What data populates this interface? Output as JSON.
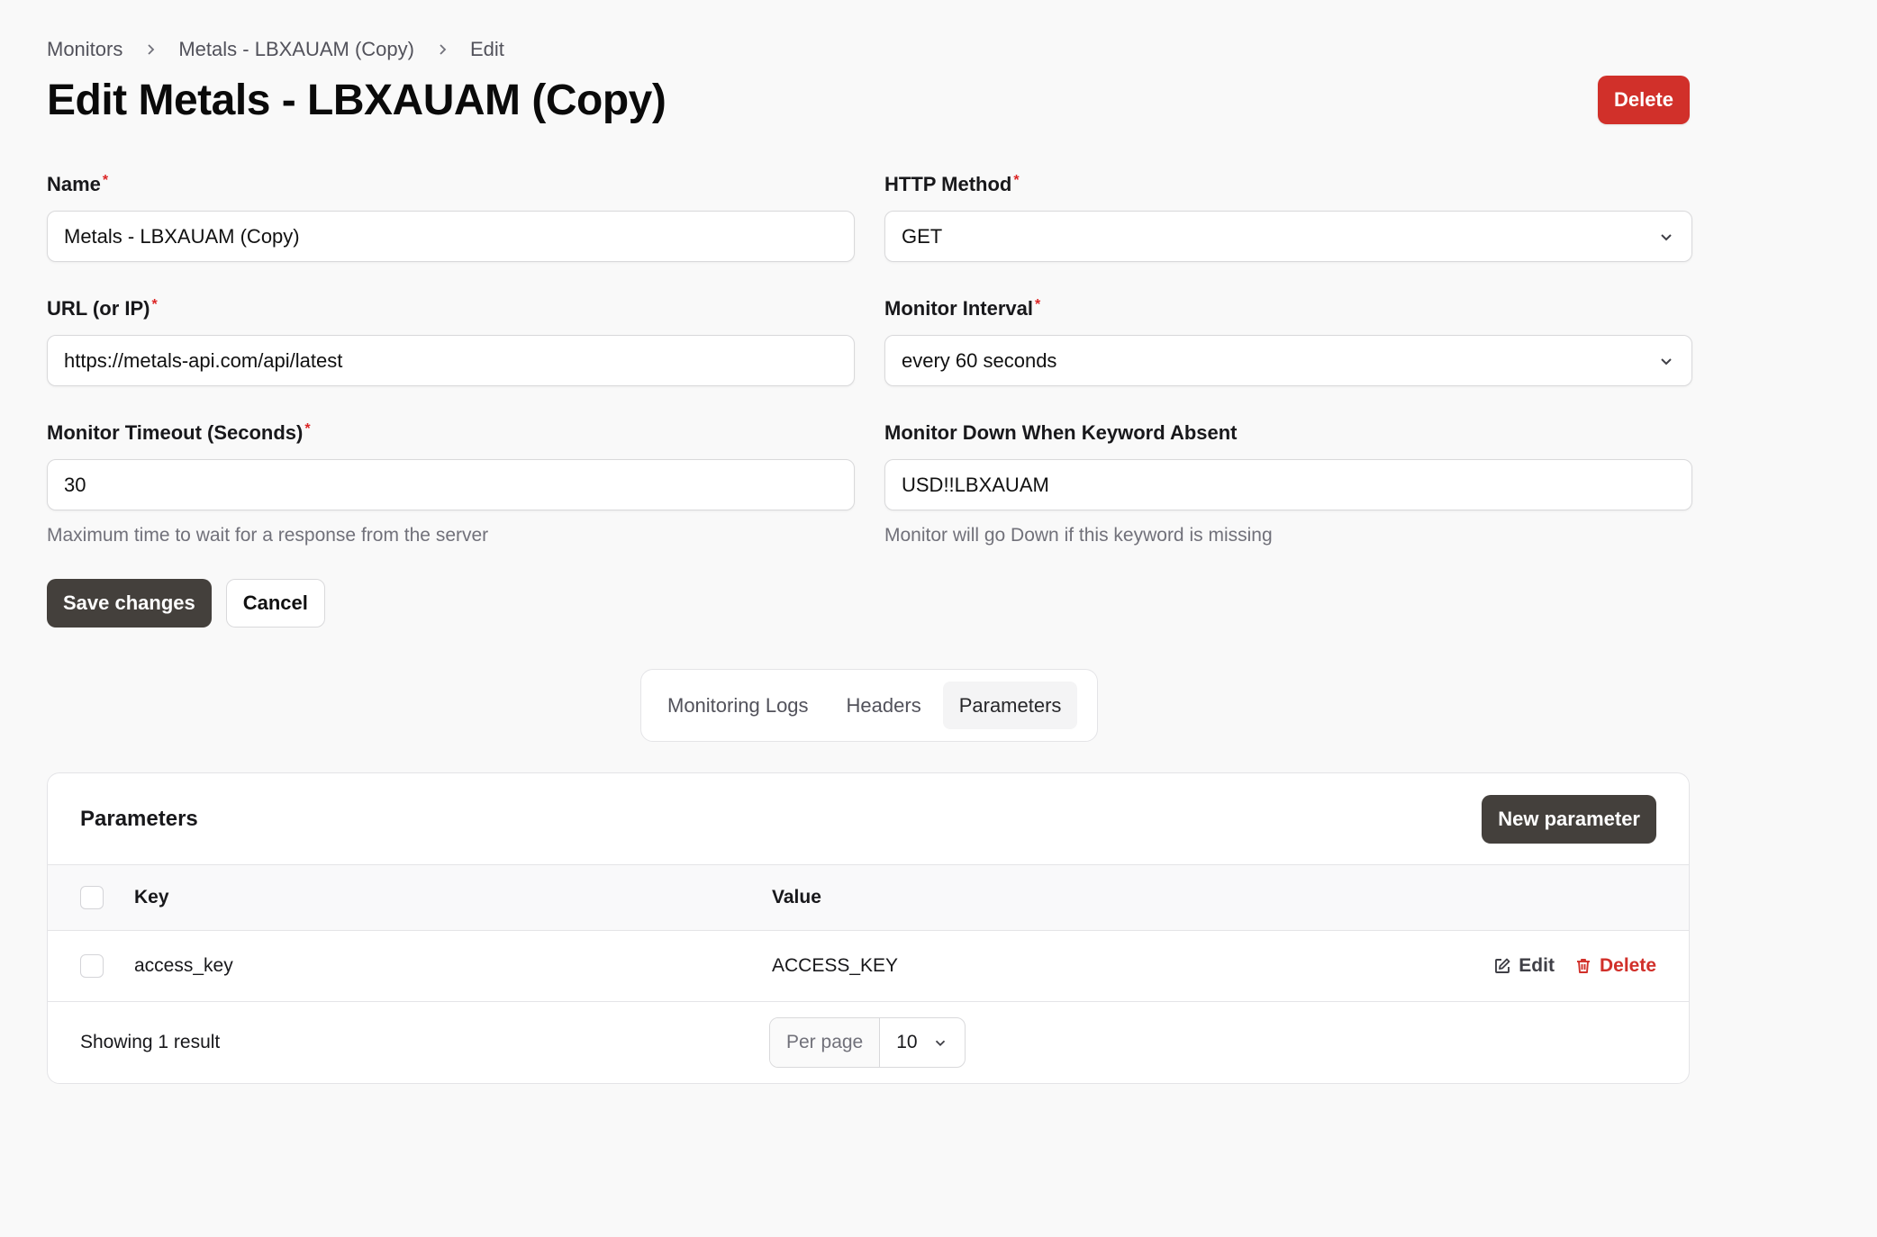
{
  "breadcrumb": {
    "items": [
      "Monitors",
      "Metals - LBXAUAM (Copy)",
      "Edit"
    ]
  },
  "page": {
    "title": "Edit Metals - LBXAUAM (Copy)",
    "delete_label": "Delete"
  },
  "form": {
    "name": {
      "label": "Name",
      "required": "*",
      "value": "Metals - LBXAUAM (Copy)"
    },
    "http_method": {
      "label": "HTTP Method",
      "required": "*",
      "value": "GET"
    },
    "url": {
      "label": "URL (or IP)",
      "required": "*",
      "value": "https://metals-api.com/api/latest"
    },
    "interval": {
      "label": "Monitor Interval",
      "required": "*",
      "value": "every 60 seconds"
    },
    "timeout": {
      "label": "Monitor Timeout (Seconds)",
      "required": "*",
      "value": "30",
      "hint": "Maximum time to wait for a response from the server"
    },
    "keyword": {
      "label": "Monitor Down When Keyword Absent",
      "value": "USD!!LBXAUAM",
      "hint": "Monitor will go Down if this keyword is missing"
    },
    "save_label": "Save changes",
    "cancel_label": "Cancel"
  },
  "tabs": [
    {
      "label": "Monitoring Logs",
      "active": false
    },
    {
      "label": "Headers",
      "active": false
    },
    {
      "label": "Parameters",
      "active": true
    }
  ],
  "parameters": {
    "title": "Parameters",
    "new_label": "New parameter",
    "columns": {
      "key": "Key",
      "value": "Value"
    },
    "rows": [
      {
        "key": "access_key",
        "value": "ACCESS_KEY",
        "edit_label": "Edit",
        "delete_label": "Delete"
      }
    ],
    "footer": {
      "count": "Showing 1 result",
      "per_page_label": "Per page",
      "per_page_value": "10"
    }
  },
  "colors": {
    "danger": "#d1302a",
    "dark_button": "#44403c",
    "background": "#f9f9f9"
  },
  "icons": [
    "chevron-right-icon",
    "chevron-down-icon",
    "edit-icon",
    "trash-icon"
  ]
}
